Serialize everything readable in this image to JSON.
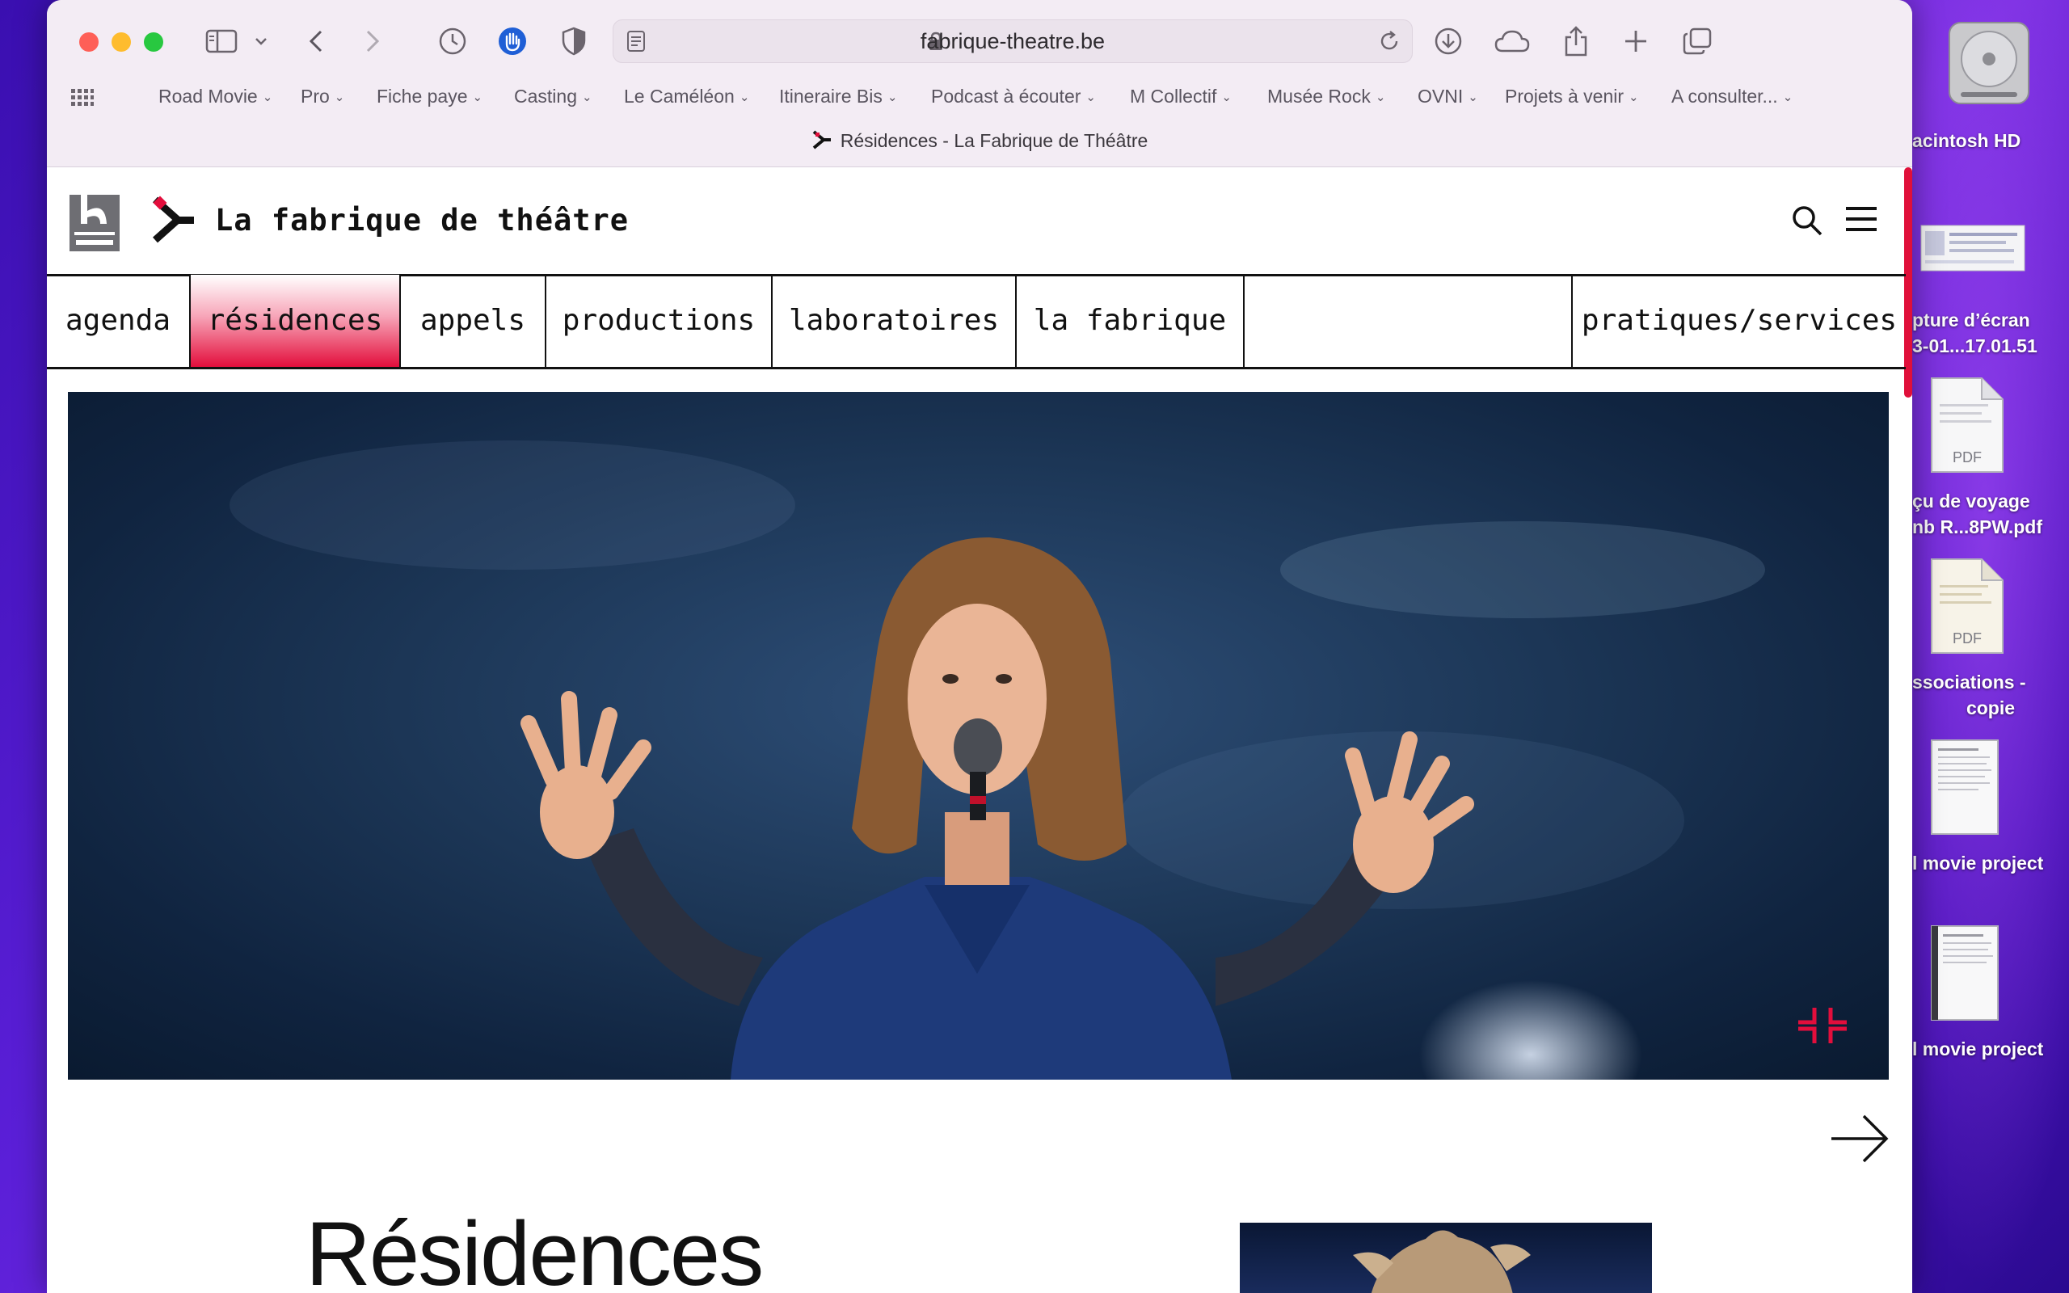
{
  "browser": {
    "url": "fabrique-theatre.be",
    "tab_title": "Résidences - La Fabrique de Théâtre",
    "bookmarks": [
      "Road Movie",
      "Pro",
      "Fiche paye",
      "Casting",
      "Le Caméléon",
      "Itineraire Bis",
      "Podcast à écouter",
      "M Collectif",
      "Musée Rock",
      "OVNI",
      "Projets à venir",
      "A consulter..."
    ]
  },
  "site": {
    "name": "La fabrique de théâtre",
    "province_logo": "Province de HAINAUT",
    "nav": [
      "agenda",
      "résidences",
      "appels",
      "productions",
      "laboratoires",
      "la fabrique",
      "pratiques/services"
    ],
    "active_nav": "résidences",
    "section_title": "Résidences"
  },
  "desktop": {
    "items": [
      "acintosh HD",
      "pture d’écran",
      "3-01...17.01.51",
      "çu de voyage",
      "nb R...8PW.pdf",
      "ssociations -",
      "copie",
      "l movie project",
      "l movie project"
    ],
    "pdf_badge": "PDF"
  },
  "colors": {
    "accent": "#e30e3c",
    "chrome": "#f3ecf4"
  },
  "icons": [
    "sidebar-icon",
    "back-icon",
    "forward-icon",
    "history-icon",
    "privacy-icon",
    "shield-icon",
    "lock-icon",
    "reload-icon",
    "download-icon",
    "cloud-icon",
    "share-icon",
    "plus-icon",
    "tabs-icon",
    "search-icon",
    "menu-icon",
    "arrow-right-icon"
  ]
}
